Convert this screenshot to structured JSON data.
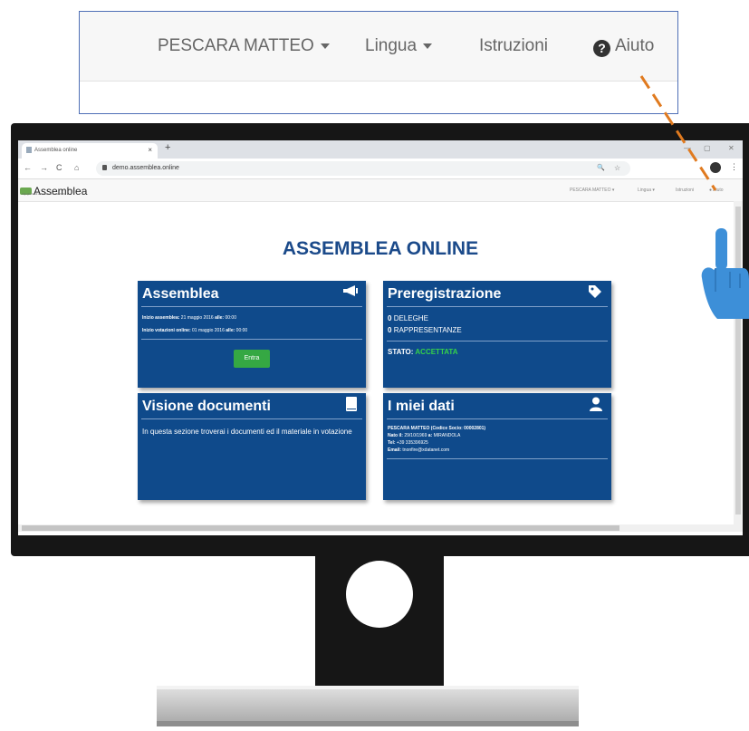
{
  "zoom_nav": {
    "user": "PESCARA MATTEO",
    "language": "Lingua",
    "instructions": "Istruzioni",
    "help": "Aiuto",
    "help_glyph": "?"
  },
  "browser": {
    "tab_title": "Assemblea online",
    "tab_close": "×",
    "new_tab": "+",
    "win_minimize": "—",
    "win_maximize": "▢",
    "win_close": "✕",
    "back": "←",
    "forward": "→",
    "reload": "C",
    "home": "⌂",
    "url": "demo.assemblea.online",
    "zoom_glyph": "🔍",
    "star_glyph": "☆",
    "menu_glyph": "⋮"
  },
  "site_nav": {
    "brand": "Assemblea",
    "brand_tagline": "Ingegneria di soluzioni ICT dal 2001",
    "user": "PESCARA MATTEO",
    "language": "Lingua",
    "instructions": "Istruzioni",
    "help": "Aiuto"
  },
  "page": {
    "title": "ASSEMBLEA ONLINE"
  },
  "cards": {
    "assemblea": {
      "title": "Assemblea",
      "icon": "megaphone-icon",
      "start_label": "Inizio assemblea:",
      "start_date": "21 maggio 2016",
      "start_time_label": "alle:",
      "start_time": "00:00",
      "vote_label": "Inizio votazioni online:",
      "vote_date": "01 maggio 2016",
      "vote_time_label": "alle:",
      "vote_time": "00:00",
      "button": "Entra"
    },
    "preregistrazione": {
      "title": "Preregistrazione",
      "icon": "tag-icon",
      "deleghe_count": "0",
      "deleghe_label": "DELEGHE",
      "rappresentanze_count": "0",
      "rappresentanze_label": "RAPPRESENTANZE",
      "status_label": "STATO:",
      "status_value": "ACCETTATA",
      "status_color": "#35d24a"
    },
    "documenti": {
      "title": "Visione documenti",
      "icon": "book-icon",
      "description": "In questa sezione troverai i documenti ed il materiale in votazione"
    },
    "dati": {
      "title": "I miei dati",
      "icon": "user-icon",
      "name": "PESCARA MATTEO",
      "code_label": "(Codice Socio: 00002801)",
      "birth_label": "Nato il:",
      "birth_date": "29/10/1969",
      "birth_place_label": "a:",
      "birth_place": "MIRANDOLA",
      "tel_label": "Tel:",
      "tel": "+39 335396925",
      "email_label": "Email:",
      "email": "tnonfire@xdatanet.com"
    }
  },
  "colors": {
    "card_blue": "#0f4a8b",
    "title_blue": "#1b4a8a",
    "button_green": "#35a843",
    "pointer_orange": "#e07a1f",
    "hand_blue": "#3d8fd8"
  }
}
